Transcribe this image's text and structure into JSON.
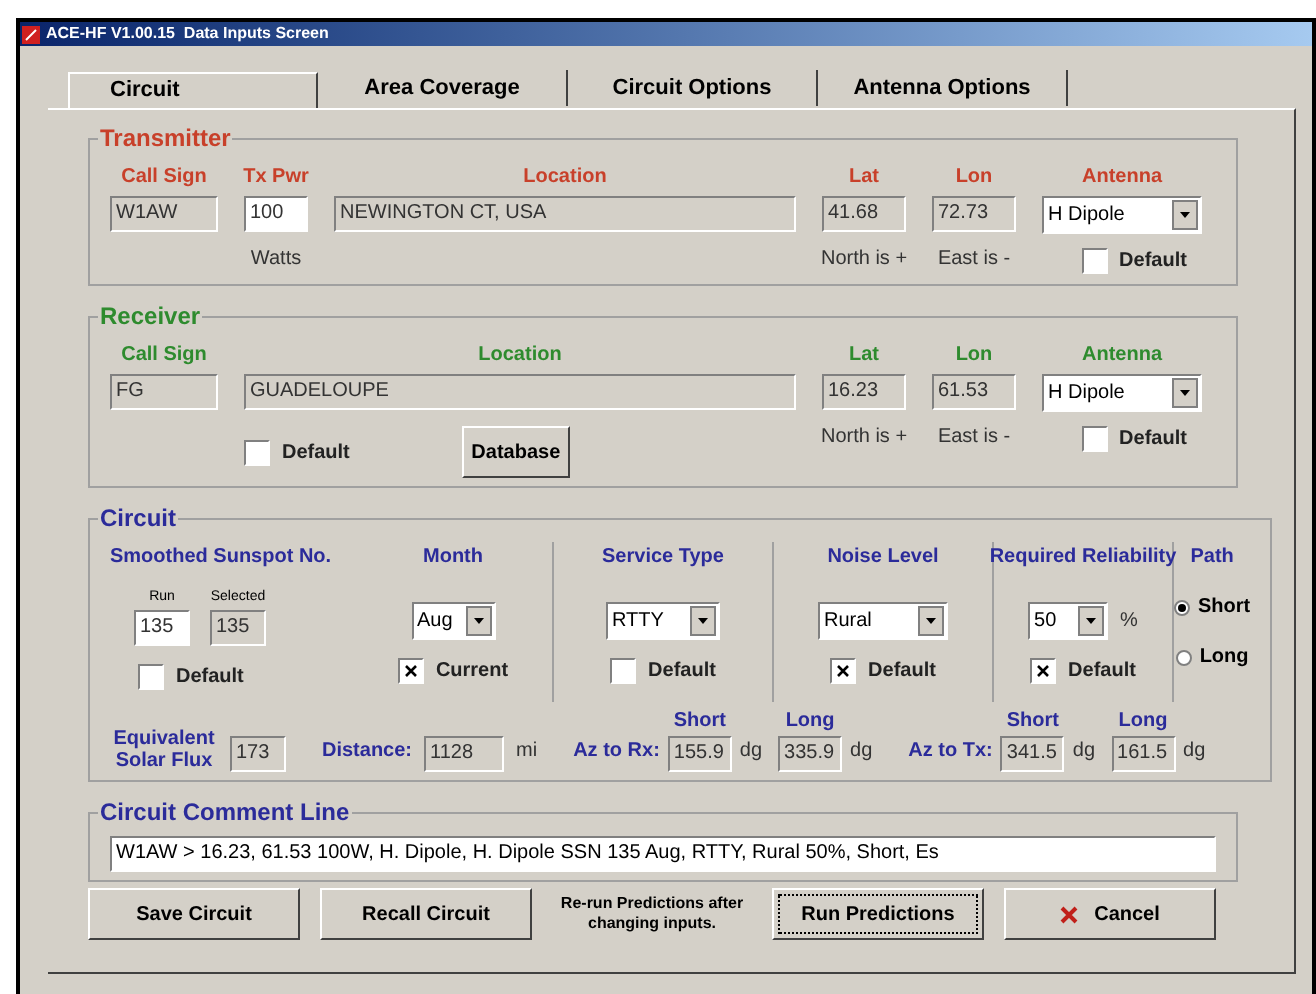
{
  "window": {
    "title": "ACE-HF V1.00.15  Data Inputs Screen"
  },
  "tabs": [
    {
      "label": "Circuit",
      "selected": true
    },
    {
      "label": "Area Coverage",
      "selected": false
    },
    {
      "label": "Circuit Options",
      "selected": false
    },
    {
      "label": "Antenna Options",
      "selected": false
    }
  ],
  "transmitter": {
    "title": "Transmitter",
    "call_sign": {
      "label": "Call Sign",
      "value": "W1AW"
    },
    "tx_power": {
      "label": "Tx Pwr",
      "value": "100",
      "unit": "Watts"
    },
    "location": {
      "label": "Location",
      "value": "NEWINGTON CT, USA"
    },
    "lat": {
      "label": "Lat",
      "value": "41.68",
      "hint": "North is +"
    },
    "lon": {
      "label": "Lon",
      "value": "72.73",
      "hint": "East is -"
    },
    "antenna": {
      "label": "Antenna",
      "value": "H Dipole",
      "default_label": "Default",
      "default_checked": false
    }
  },
  "receiver": {
    "title": "Receiver",
    "call_sign": {
      "label": "Call Sign",
      "value": "FG"
    },
    "location": {
      "label": "Location",
      "value": "GUADELOUPE",
      "default_label": "Default",
      "default_checked": false
    },
    "database_button": "Database",
    "lat": {
      "label": "Lat",
      "value": "16.23",
      "hint": "North is +"
    },
    "lon": {
      "label": "Lon",
      "value": "61.53",
      "hint": "East is -"
    },
    "antenna": {
      "label": "Antenna",
      "value": "H Dipole",
      "default_label": "Default",
      "default_checked": false
    }
  },
  "circuit": {
    "title": "Circuit",
    "sunspot": {
      "label": "Smoothed Sunspot No.",
      "run_label": "Run",
      "run_value": "135",
      "selected_label": "Selected",
      "selected_value": "135",
      "default_label": "Default",
      "default_checked": false
    },
    "month": {
      "label": "Month",
      "value": "Aug",
      "current_label": "Current",
      "current_checked": true
    },
    "service": {
      "label": "Service Type",
      "value": "RTTY",
      "default_label": "Default",
      "default_checked": false
    },
    "noise": {
      "label": "Noise Level",
      "value": "Rural",
      "default_label": "Default",
      "default_checked": true
    },
    "reliability": {
      "label": "Required Reliability",
      "value": "50",
      "unit": "%",
      "default_label": "Default",
      "default_checked": true
    },
    "path": {
      "label": "Path",
      "options": [
        {
          "label": "Short",
          "selected": true
        },
        {
          "label": "Long",
          "selected": false
        }
      ]
    },
    "solar_flux": {
      "label": "Equivalent Solar Flux",
      "value": "173"
    },
    "distance": {
      "label": "Distance:",
      "value": "1128",
      "unit": "mi"
    },
    "azimuths": [
      {
        "label": "Az to Rx:",
        "short_label": "Short",
        "short_value": "155.9",
        "short_unit": "dg",
        "long_label": "Long",
        "long_value": "335.9",
        "long_unit": "dg"
      },
      {
        "label": "Az to Tx:",
        "short_label": "Short",
        "short_value": "341.5",
        "short_unit": "dg",
        "long_label": "Long",
        "long_value": "161.5",
        "long_unit": "dg"
      }
    ]
  },
  "comment": {
    "title": "Circuit Comment Line",
    "value": "W1AW > 16.23, 61.53 100W, H. Dipole, H. Dipole SSN 135 Aug, RTTY, Rural 50%, Short, Es"
  },
  "actions": {
    "save": "Save Circuit",
    "recall": "Recall Circuit",
    "note": "Re-run Predictions after changing inputs.",
    "run": "Run Predictions",
    "cancel": "Cancel"
  }
}
